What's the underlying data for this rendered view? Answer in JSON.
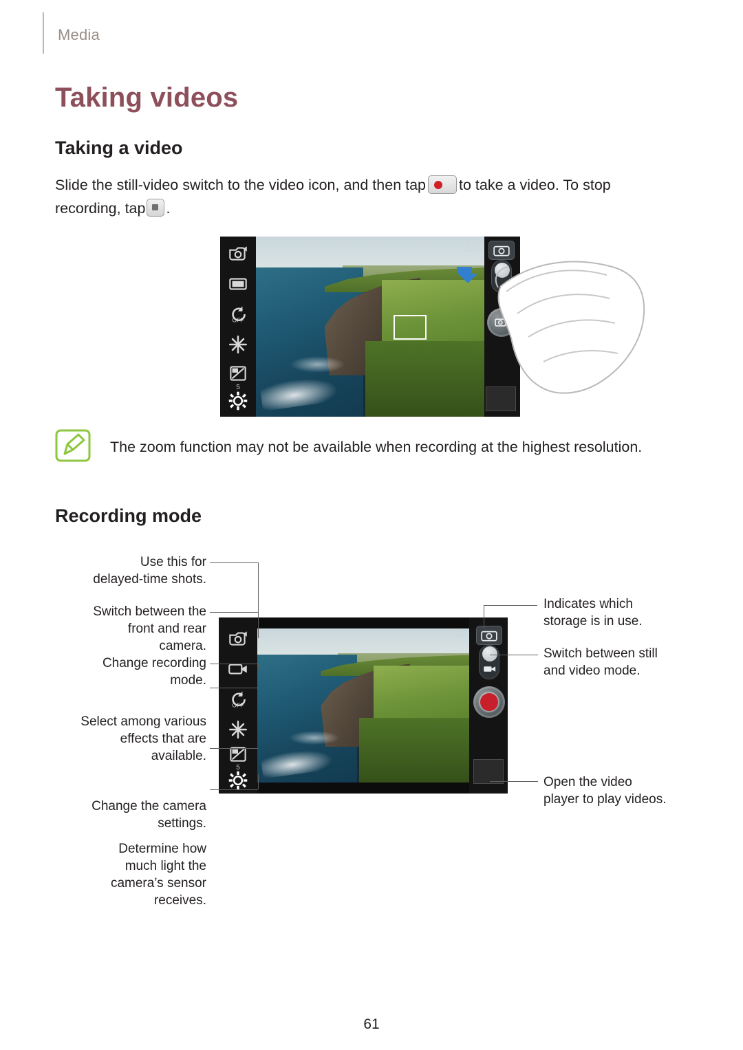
{
  "breadcrumb": "Media",
  "title": "Taking videos",
  "section1": {
    "heading": "Taking a video",
    "paragraph_part1": "Slide the still-video switch to the video icon, and then tap",
    "paragraph_part2": "to take a video. To stop",
    "paragraph_part3": "recording, tap",
    "paragraph_part4": ".",
    "record_icon": "record-button-icon",
    "stop_icon": "stop-button-icon"
  },
  "note": {
    "icon": "note-pencil-icon",
    "text": "The zoom function may not be available when recording at the highest resolution."
  },
  "section2": {
    "heading": "Recording mode"
  },
  "figure1": {
    "name": "camera-preview-with-hand",
    "left_icons": [
      "self-portrait-icon",
      "shooting-mode-icon",
      "flash-off-icon",
      "effects-icon",
      "exposure-icon",
      "settings-icon"
    ],
    "exposure_value": "5",
    "flash_label": "OFF",
    "right_icons": [
      "storage-icon",
      "still-video-switch",
      "shutter-button",
      "gallery-thumbnail"
    ],
    "top_right_icon": "storage-sd-icon"
  },
  "figure2": {
    "name": "recording-mode-annotated-diagram",
    "left_icons": [
      "self-portrait-icon",
      "recording-mode-icon",
      "flash-off-icon",
      "effects-icon",
      "exposure-icon",
      "settings-icon"
    ],
    "exposure_value": "5",
    "flash_label": "OFF",
    "callouts_left": [
      "Use this for\ndelayed-time shots.",
      "Switch between the\nfront and rear\ncamera.",
      "Change recording\nmode.",
      "Select among various\neffects that are\navailable.",
      "Change the camera\nsettings.",
      "Determine how\nmuch light the\ncamera’s sensor\nreceives."
    ],
    "callouts_right": [
      "Indicates which\nstorage is in use.",
      "Switch between still\nand video mode.",
      "Open the video\nplayer to play videos."
    ],
    "callout_left_1_line1": "Use this for",
    "callout_left_1_line2": "delayed-time shots.",
    "callout_left_2_line1": "Switch between the",
    "callout_left_2_line2": "front and rear",
    "callout_left_2_line3": "camera.",
    "callout_left_3_line1": "Change recording",
    "callout_left_3_line2": "mode.",
    "callout_left_4_line1": "Select among various",
    "callout_left_4_line2": "effects that are",
    "callout_left_4_line3": "available.",
    "callout_left_5_line1": "Change the camera",
    "callout_left_5_line2": "settings.",
    "callout_left_6_line1": "Determine how",
    "callout_left_6_line2": "much light the",
    "callout_left_6_line3": "camera’s sensor",
    "callout_left_6_line4": "receives.",
    "callout_right_1_line1": "Indicates which",
    "callout_right_1_line2": "storage is in use.",
    "callout_right_2_line1": "Switch between still",
    "callout_right_2_line2": "and video mode.",
    "callout_right_3_line1": "Open the video",
    "callout_right_3_line2": "player to play videos."
  },
  "page_number": "61"
}
